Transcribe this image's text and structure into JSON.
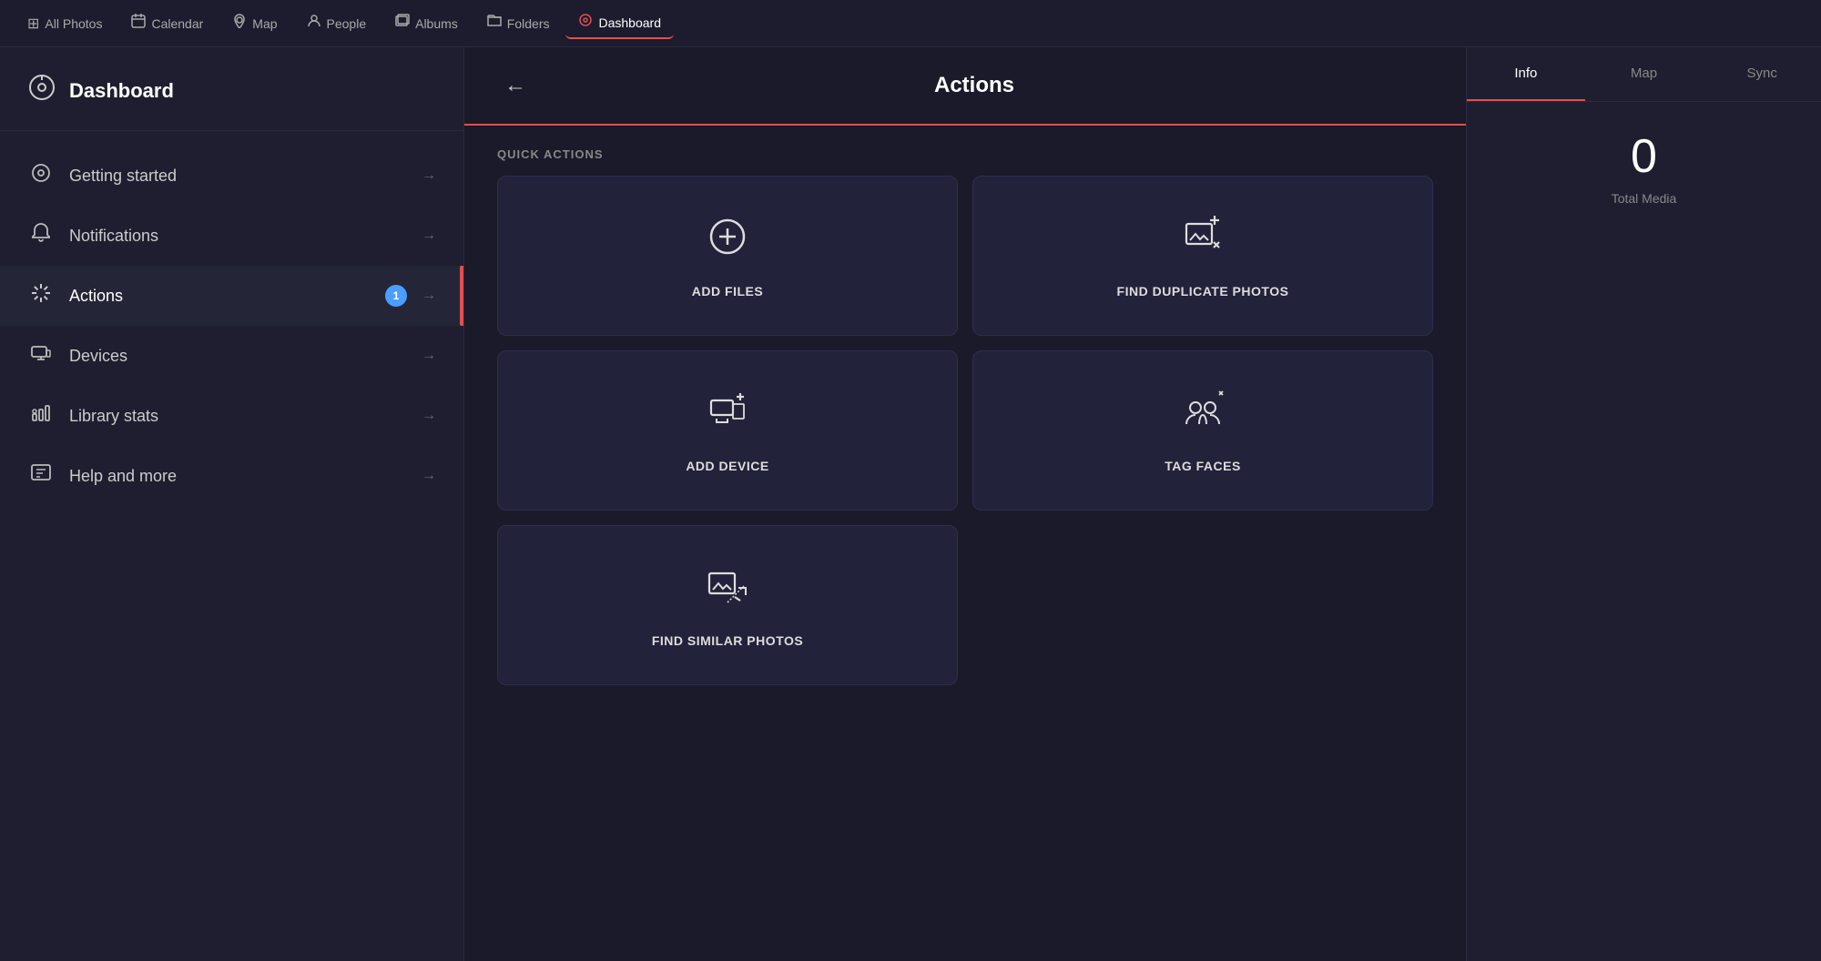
{
  "topNav": {
    "items": [
      {
        "id": "all-photos",
        "label": "All Photos",
        "icon": "⊞",
        "active": false
      },
      {
        "id": "calendar",
        "label": "Calendar",
        "icon": "📅",
        "active": false
      },
      {
        "id": "map",
        "label": "Map",
        "icon": "📍",
        "active": false
      },
      {
        "id": "people",
        "label": "People",
        "icon": "👤",
        "active": false
      },
      {
        "id": "albums",
        "label": "Albums",
        "icon": "🖼",
        "active": false
      },
      {
        "id": "folders",
        "label": "Folders",
        "icon": "📁",
        "active": false
      },
      {
        "id": "dashboard",
        "label": "Dashboard",
        "icon": "⊙",
        "active": true
      }
    ]
  },
  "sidebar": {
    "header": {
      "icon": "⊙",
      "title": "Dashboard"
    },
    "items": [
      {
        "id": "getting-started",
        "label": "Getting started",
        "icon": "◎",
        "active": false,
        "badge": null
      },
      {
        "id": "notifications",
        "label": "Notifications",
        "icon": "🔔",
        "active": false,
        "badge": null
      },
      {
        "id": "actions",
        "label": "Actions",
        "icon": "✦",
        "active": true,
        "badge": "1"
      },
      {
        "id": "devices",
        "label": "Devices",
        "icon": "💻",
        "active": false,
        "badge": null
      },
      {
        "id": "library-stats",
        "label": "Library stats",
        "icon": "📊",
        "active": false,
        "badge": null
      },
      {
        "id": "help-and-more",
        "label": "Help and more",
        "icon": "📖",
        "active": false,
        "badge": null
      }
    ]
  },
  "centerPanel": {
    "backButton": "←",
    "title": "Actions",
    "quickActionsLabel": "QUICK ACTIONS",
    "actions": [
      {
        "id": "add-files",
        "label": "ADD FILES",
        "icon": "add-files"
      },
      {
        "id": "find-duplicate",
        "label": "FIND DUPLICATE PHOTOS",
        "icon": "find-duplicate"
      },
      {
        "id": "add-device",
        "label": "ADD DEVICE",
        "icon": "add-device"
      },
      {
        "id": "tag-faces",
        "label": "TAG FACES",
        "icon": "tag-faces"
      },
      {
        "id": "find-similar",
        "label": "FIND SIMILAR PHOTOS",
        "icon": "find-similar"
      }
    ]
  },
  "rightPanel": {
    "tabs": [
      {
        "id": "info",
        "label": "Info",
        "active": true
      },
      {
        "id": "map",
        "label": "Map",
        "active": false
      },
      {
        "id": "sync",
        "label": "Sync",
        "active": false
      }
    ],
    "totalMedia": {
      "count": "0",
      "label": "Total Media"
    }
  }
}
